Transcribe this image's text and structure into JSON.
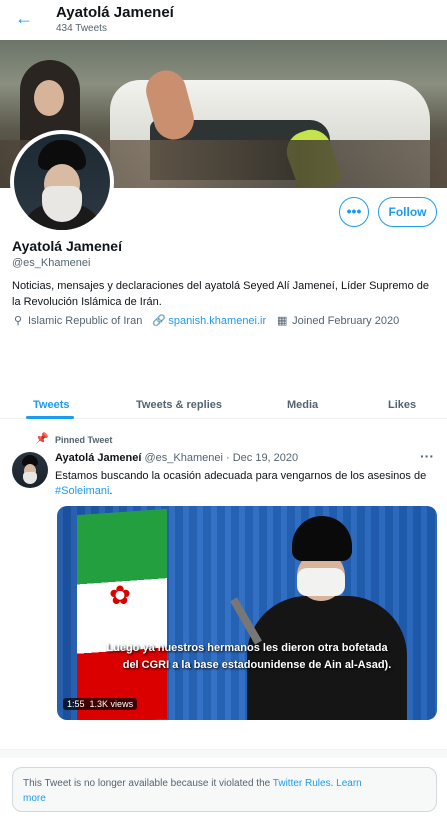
{
  "header": {
    "back_icon": "arrow-left-icon",
    "title": "Ayatolá Jameneí",
    "tweet_count": "434 Tweets"
  },
  "profile": {
    "name": "Ayatolá Jameneí",
    "handle": "@es_Khamenei",
    "bio": "Noticias, mensajes y declaraciones del ayatolá Seyed Alí Jameneí, Líder Supremo de la Revolución Islámica de Irán.",
    "location": "Islamic Republic of Iran",
    "website": "spanish.khamenei.ir",
    "joined": "Joined February 2020",
    "follow_label": "Follow",
    "more_label": "•••"
  },
  "tabs": [
    {
      "label": "Tweets",
      "active": true
    },
    {
      "label": "Tweets & replies",
      "active": false
    },
    {
      "label": "Media",
      "active": false
    },
    {
      "label": "Likes",
      "active": false
    }
  ],
  "pinned_tweet": {
    "pinned_label": "Pinned Tweet",
    "author_name": "Ayatolá Jameneí",
    "author_handle": "@es_Khamenei",
    "date": "· Dec 19, 2020",
    "menu": "···",
    "text_before": "Estamos buscando la ocasión adecuada para vengarnos de los asesinos de ",
    "hashtag": "#Soleimani",
    "text_after": ".",
    "video": {
      "subtitle_line1": "Luego ya nuestros hermanos les dieron otra bofetada",
      "subtitle_line2": "del CGRI a la base estadounidense de Ain al-Asad).",
      "duration": "1:55",
      "views": "1.3K views"
    }
  },
  "notice": {
    "text": "This Tweet is no longer available because it violated the ",
    "link1": "Twitter Rules",
    "text2": ". ",
    "link2_a": "Learn",
    "link2_b": "more"
  },
  "colors": {
    "accent": "#1d9bf0",
    "secondary_text": "#536471"
  }
}
